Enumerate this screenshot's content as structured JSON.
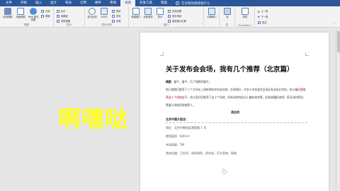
{
  "ribbon": {
    "tabs": [
      "文件",
      "开始",
      "插入",
      "设计",
      "布局",
      "引用",
      "邮件",
      "审阅",
      "视图",
      "开发工具",
      "帮助"
    ],
    "active_tab": "视图",
    "tell_me": "告诉我你想要做什么",
    "groups": {
      "views": {
        "label": "视图",
        "buttons": [
          "阅读视图",
          "页面视图",
          "Web 版式视图"
        ],
        "small": [
          "大纲",
          "草稿"
        ]
      },
      "show": {
        "label": "显示",
        "items": [
          "标尺",
          "网格线",
          "导航窗格"
        ]
      },
      "zoom": {
        "label": "显示比例",
        "buttons": [
          "显示比例",
          "100%"
        ],
        "small": [
          "单页",
          "多页",
          "页宽"
        ]
      },
      "window": {
        "label": "窗口",
        "buttons": [
          "新建窗口",
          "全部重排",
          "拆分"
        ],
        "small": [
          "并排查看",
          "同步滚动",
          "重设窗口位置"
        ]
      },
      "switch": {
        "buttons": [
          "切换窗口"
        ]
      },
      "macros": {
        "label": "宏",
        "buttons": [
          "宏"
        ]
      },
      "sharepoint": {
        "label": "SharePoint",
        "buttons": [
          "属性"
        ]
      },
      "arrows": [
        "上一条",
        "下一条",
        "批注"
      ]
    }
  },
  "overlay_text": "啊嘿哒",
  "document": {
    "title": "关于发布会会场，我有几个推荐（北京篇）",
    "intro_label": "摘要：",
    "intro": "备牛，备牛，为了理想而备牛。",
    "paragraph1_a": "前几期我们推荐了十个方向在上海新地的发布会场地，反响很好，",
    "paragraph1_b": "许多小伙伴留言会场还有没有北京的，说小编",
    "paragraph1_red": "还是推荐这十个场地",
    "paragraph1_c": "这不，给大家好好推荐了这十个场地，所有场地均经过小编实地考察，赶紧收藏起来吧！",
    "paragraph1_d": "家活动的策划、策展与场地资源推荐人。",
    "section_heading": "酒店类：",
    "venue_name": "北京中国大饭店：",
    "address": "地址：北京市朝阳区建国路 1 号",
    "area": "使用面积：649 m²",
    "height": "布场高度：5M",
    "facilities": "其他设施：卫生间、休息场所、停车场、灯光音响、网络"
  },
  "colors": {
    "ribbon_blue": "#2b579a",
    "overlay_yellow": "#ffff1a",
    "accent_red": "#c00000"
  }
}
